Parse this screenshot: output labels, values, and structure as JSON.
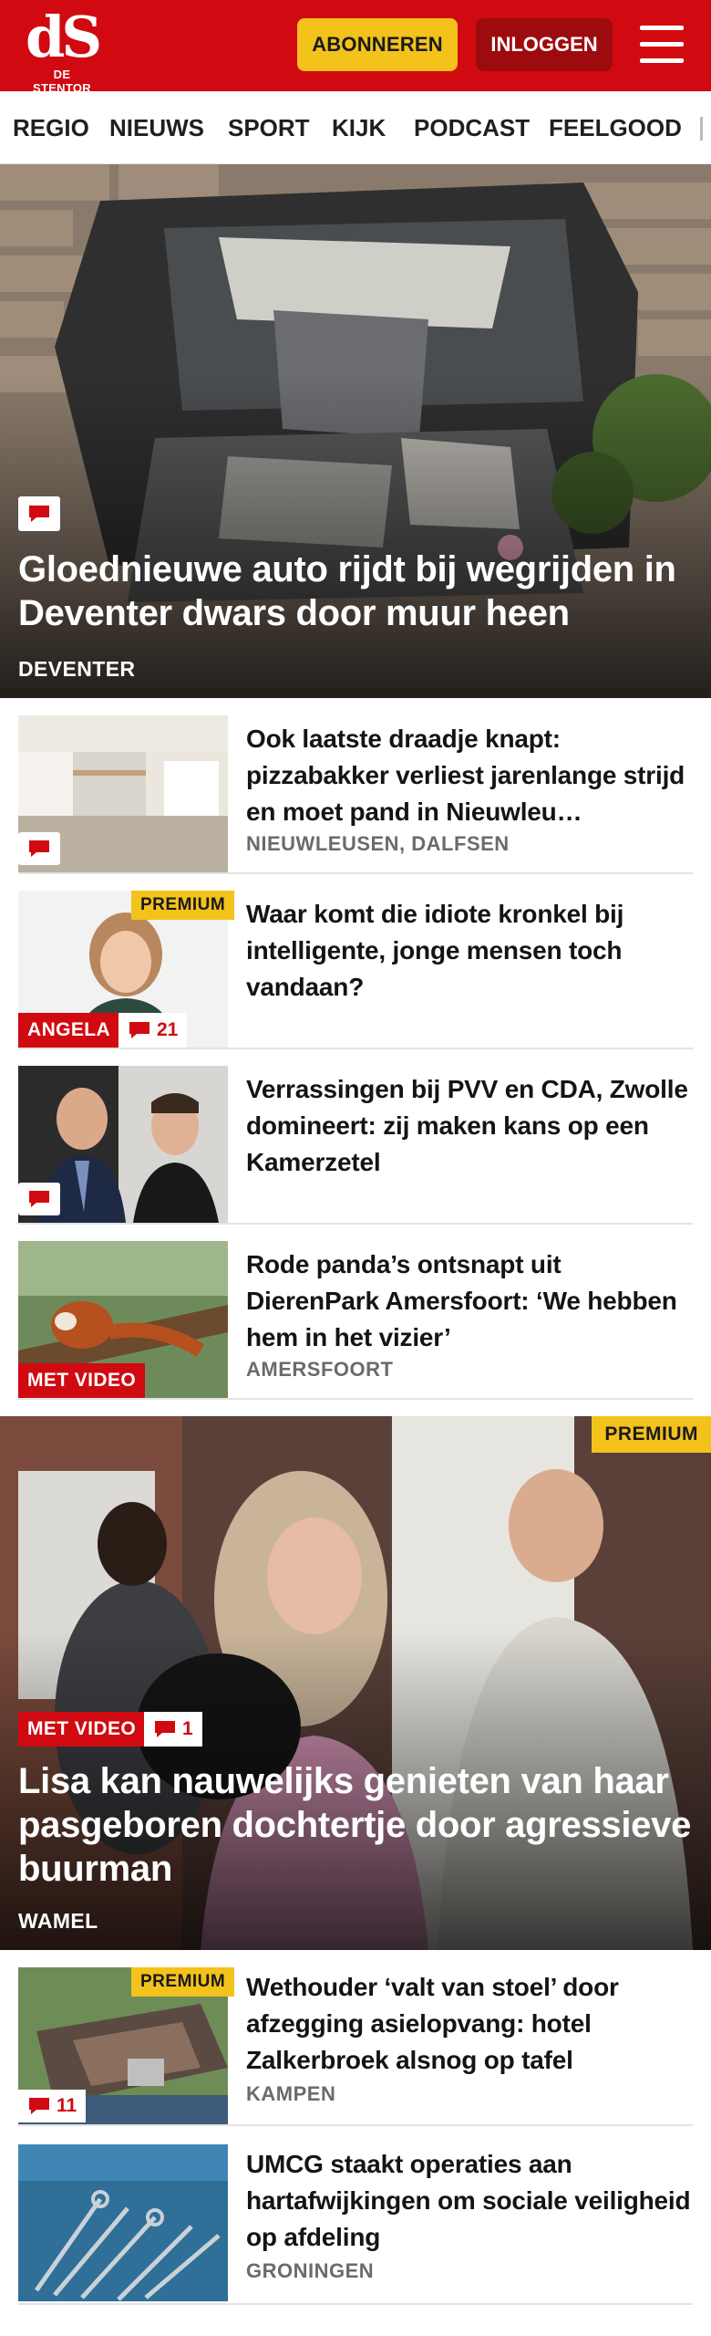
{
  "header": {
    "logo_mark": "dS",
    "logo_text": "DE STENTOR",
    "subscribe_label": "ABONNEREN",
    "login_label": "INLOGGEN"
  },
  "nav": {
    "items": [
      "REGIO",
      "NIEUWS",
      "SPORT",
      "KIJK",
      "PODCAST",
      "FEELGOOD"
    ]
  },
  "colors": {
    "brand_red": "#d10a11",
    "premium_yellow": "#f3c21b",
    "login_dark_red": "#9e0b0f"
  },
  "hero1": {
    "title": "Gloednieuwe auto rijdt bij wegrijden in Deventer dwars door muur heen",
    "location": "DEVENTER"
  },
  "articles": [
    {
      "title": "Ook laatste draadje knapt: pizzabakker verliest jarenlange strijd en moet pand in Nieuwleu…",
      "location": "NIEUWLEUSEN, DALFSEN"
    },
    {
      "title": "Waar komt die idiote kronkel bij intelligente, jonge mensen toch vandaan?",
      "premium": "PREMIUM",
      "author_badge": "ANGELA",
      "comments": "21"
    },
    {
      "title": "Verrassingen bij PVV en CDA, Zwolle domineert: zij maken kans op een Kamerzetel"
    },
    {
      "title": "Rode panda’s ontsnapt uit DierenPark Amersfoort: ‘We hebben hem in het vizier’",
      "location": "AMERSFOORT",
      "video_badge": "MET VIDEO"
    }
  ],
  "hero2": {
    "title": "Lisa kan nauwelijks genieten van haar pasgeboren dochtertje door agressieve buurman",
    "location": "WAMEL",
    "premium": "PREMIUM",
    "video_badge": "MET VIDEO",
    "comments": "1"
  },
  "articles2": [
    {
      "title": "Wethouder ‘valt van stoel’ door afzegging asielopvang: hotel Zalkerbroek alsnog op tafel",
      "location": "KAMPEN",
      "premium": "PREMIUM",
      "comments": "11"
    },
    {
      "title": "UMCG staakt operaties aan hartafwijkingen om sociale veiligheid op afdeling",
      "location": "GRONINGEN"
    }
  ]
}
